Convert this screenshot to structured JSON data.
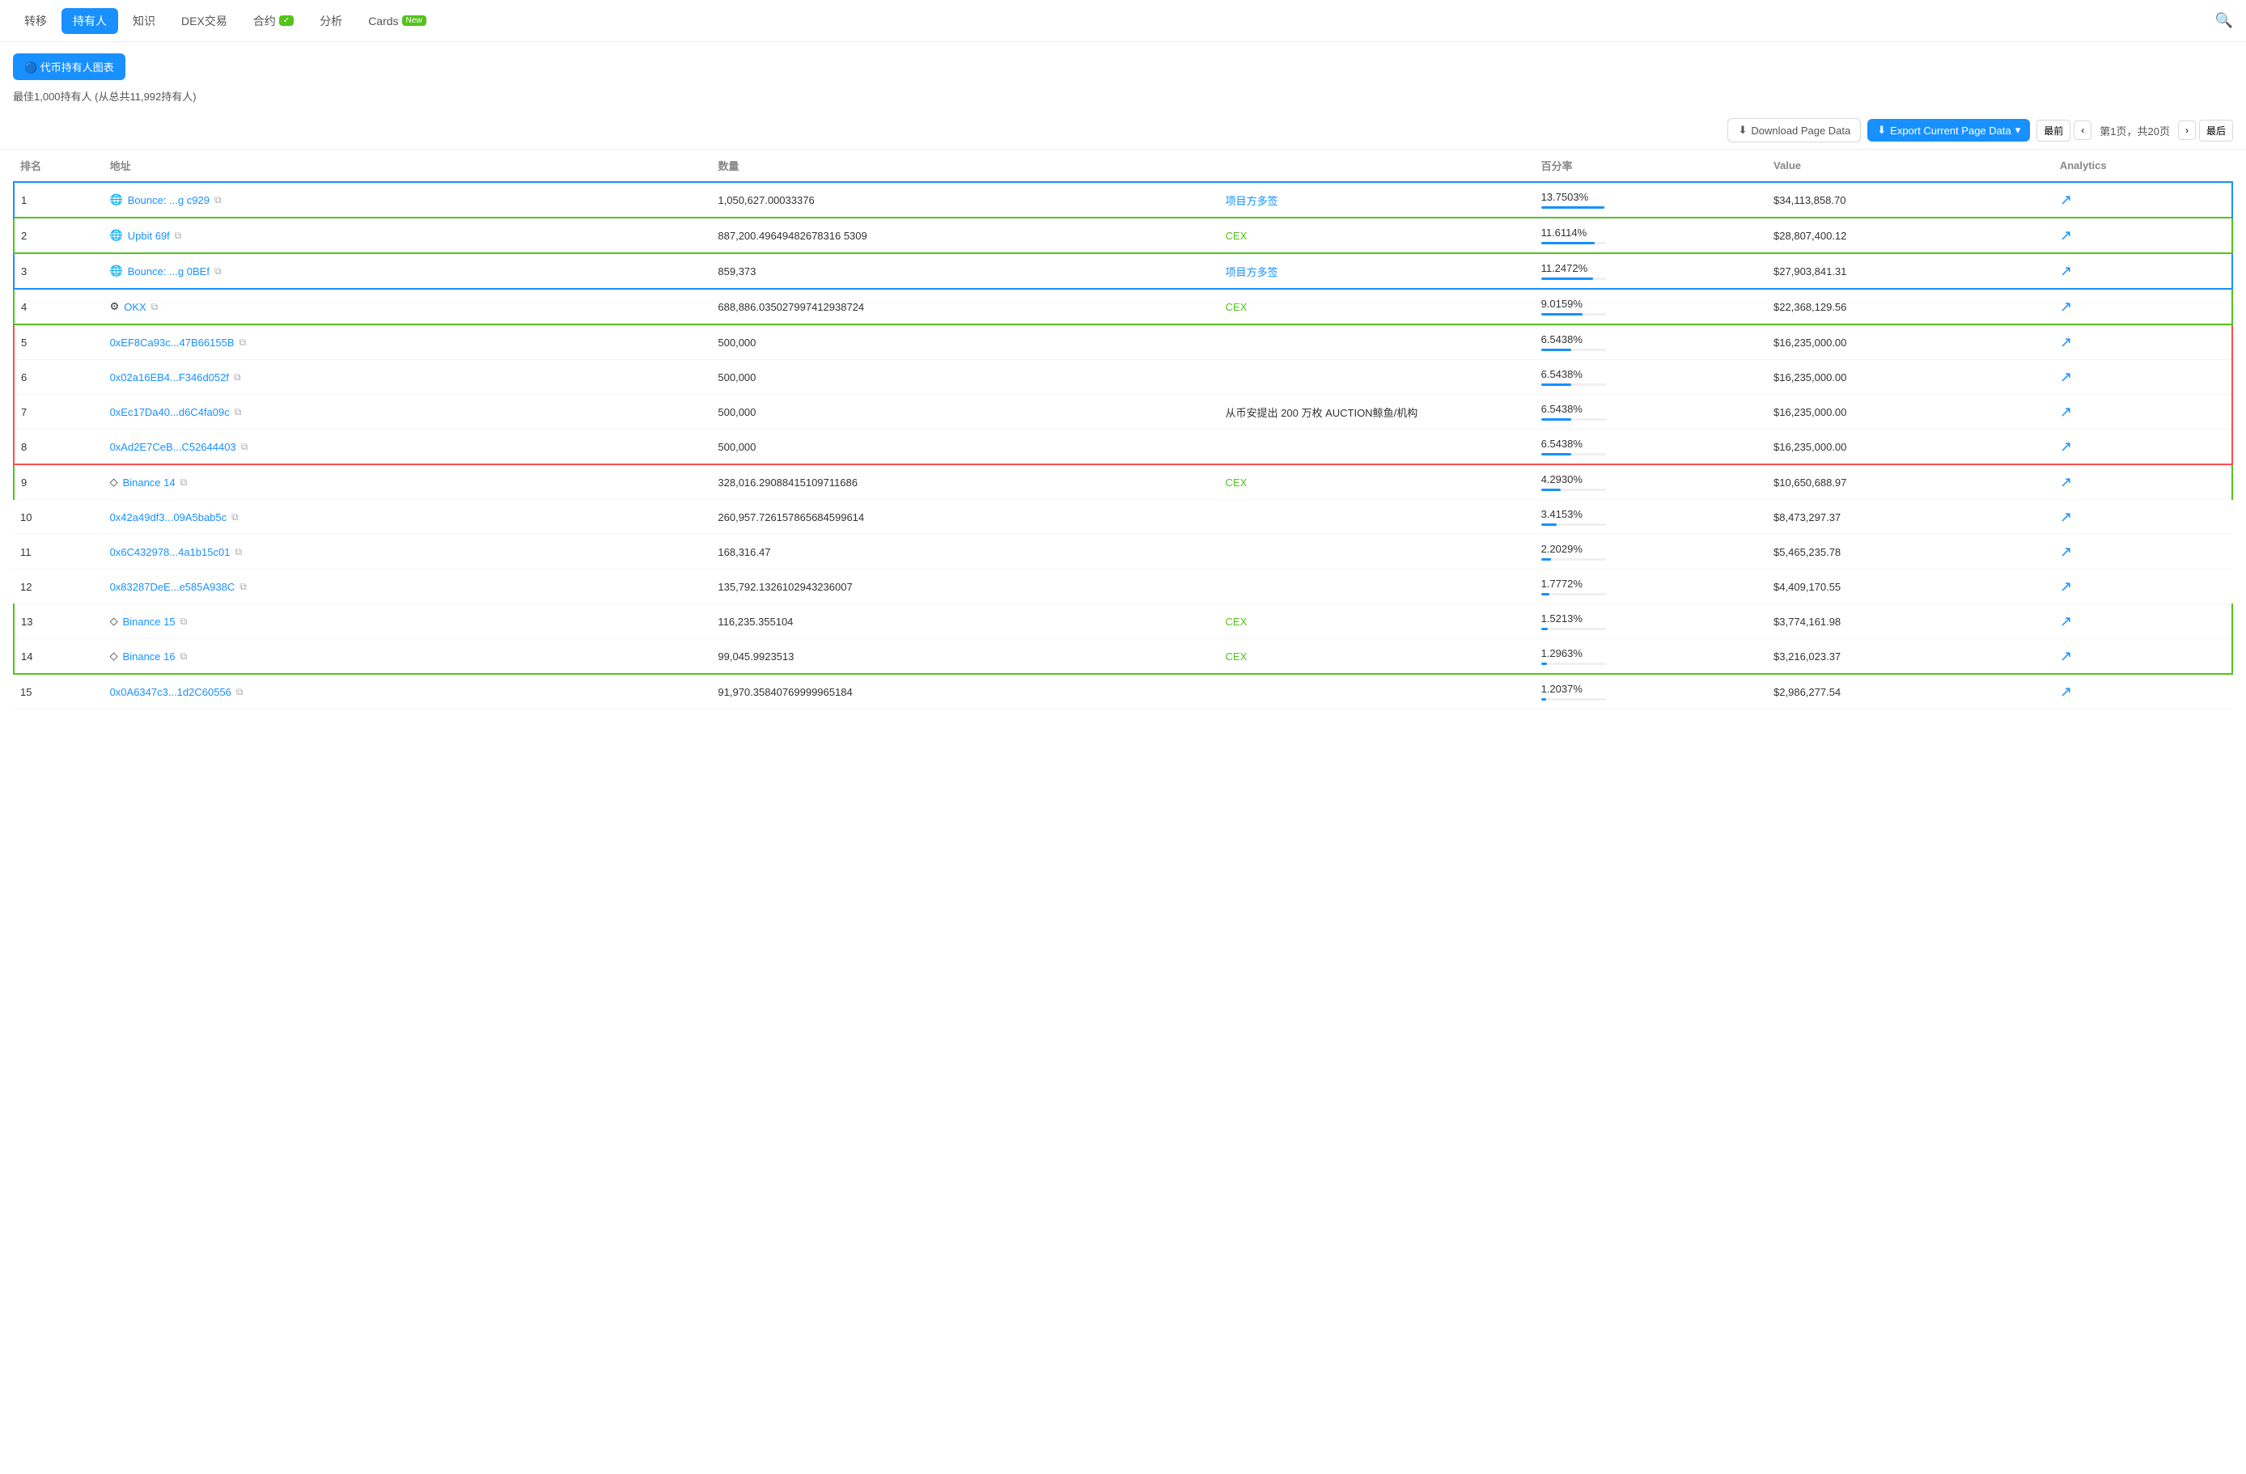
{
  "nav": {
    "items": [
      {
        "id": "transfer",
        "label": "转移",
        "active": false
      },
      {
        "id": "holders",
        "label": "持有人",
        "active": true
      },
      {
        "id": "knowledge",
        "label": "知识",
        "active": false
      },
      {
        "id": "dex",
        "label": "DEX交易",
        "active": false
      },
      {
        "id": "contract",
        "label": "合约",
        "active": false,
        "badge": "✓"
      },
      {
        "id": "analysis",
        "label": "分析",
        "active": false
      },
      {
        "id": "cards",
        "label": "Cards",
        "active": false,
        "badge": "New"
      }
    ]
  },
  "toolbar": {
    "chart_btn": "🔵 代币持有人图表",
    "subtitle": "最佳1,000持有人 (从总共11,992持有人)",
    "download_label": "Download Page Data",
    "export_label": "Export Current Page Data",
    "pagination": {
      "first": "最前",
      "prev": "‹",
      "info": "第1页，共20页",
      "next": "›",
      "last": "最后"
    }
  },
  "table": {
    "headers": [
      "排名",
      "地址",
      "数量",
      "",
      "百分率",
      "Value",
      "Analytics"
    ],
    "rows": [
      {
        "rank": "1",
        "address": "Bounce: ...g c929",
        "icon": "🌐",
        "quantity": "1,050,627.00033376",
        "label": "项目方多签",
        "label_color": "blue",
        "percent": "13.7503%",
        "percent_val": 13.7503,
        "value": "$34,113,858.70",
        "group": "blue",
        "group_pos": "start"
      },
      {
        "rank": "2",
        "address": "Upbit 69f",
        "icon": "🌐",
        "quantity": "887,200.49649482678316 5309",
        "label": "CEX",
        "label_color": "green",
        "percent": "11.6114%",
        "percent_val": 11.6114,
        "value": "$28,807,400.12",
        "group": "green",
        "group_pos": "single"
      },
      {
        "rank": "3",
        "address": "Bounce: ...g 0BEf",
        "icon": "🌐",
        "quantity": "859,373",
        "label": "项目方多签",
        "label_color": "blue",
        "percent": "11.2472%",
        "percent_val": 11.2472,
        "value": "$27,903,841.31",
        "group": "blue",
        "group_pos": "end"
      },
      {
        "rank": "4",
        "address": "OKX",
        "icon": "⚙️",
        "quantity": "688,886.035027997412938724",
        "label": "CEX",
        "label_color": "green",
        "percent": "9.0159%",
        "percent_val": 9.0159,
        "value": "$22,368,129.56",
        "group": "green2",
        "group_pos": "single"
      },
      {
        "rank": "5",
        "address": "0xEF8Ca93c...47B66155B",
        "icon": "",
        "quantity": "500,000",
        "label": "",
        "label_color": "",
        "percent": "6.5438%",
        "percent_val": 6.5438,
        "value": "$16,235,000.00",
        "group": "red",
        "group_pos": "start"
      },
      {
        "rank": "6",
        "address": "0x02a16EB4...F346d052f",
        "icon": "",
        "quantity": "500,000",
        "label": "",
        "label_color": "",
        "percent": "6.5438%",
        "percent_val": 6.5438,
        "value": "$16,235,000.00",
        "group": "red",
        "group_pos": "middle"
      },
      {
        "rank": "7",
        "address": "0xEc17Da40...d6C4fa09c",
        "icon": "",
        "quantity": "500,000",
        "label": "从币安提出 200 万枚 AUCTION鲸鱼/机构",
        "label_color": "orange",
        "percent": "6.5438%",
        "percent_val": 6.5438,
        "value": "$16,235,000.00",
        "group": "red",
        "group_pos": "middle"
      },
      {
        "rank": "8",
        "address": "0xAd2E7CeB...C52644403",
        "icon": "",
        "quantity": "500,000",
        "label": "",
        "label_color": "",
        "percent": "6.5438%",
        "percent_val": 6.5438,
        "value": "$16,235,000.00",
        "group": "red",
        "group_pos": "end"
      },
      {
        "rank": "9",
        "address": "Binance 14",
        "icon": "◇",
        "quantity": "328,016.29088415109711686",
        "label": "CEX",
        "label_color": "green",
        "percent": "4.2930%",
        "percent_val": 4.293,
        "value": "$10,650,688.97",
        "group": "green3",
        "group_pos": "start"
      },
      {
        "rank": "10",
        "address": "0x42a49df3...09A5bab5c",
        "icon": "",
        "quantity": "260,957.726157865684599614",
        "label": "",
        "label_color": "",
        "percent": "3.4153%",
        "percent_val": 3.4153,
        "value": "$8,473,297.37",
        "group": "none",
        "group_pos": ""
      },
      {
        "rank": "11",
        "address": "0x6C432978...4a1b15c01",
        "icon": "",
        "quantity": "168,316.47",
        "label": "",
        "label_color": "",
        "percent": "2.2029%",
        "percent_val": 2.2029,
        "value": "$5,465,235.78",
        "group": "none",
        "group_pos": ""
      },
      {
        "rank": "12",
        "address": "0x83287DeE...e585A938C",
        "icon": "",
        "quantity": "135,792.1326102943236007",
        "label": "",
        "label_color": "",
        "percent": "1.7772%",
        "percent_val": 1.7772,
        "value": "$4,409,170.55",
        "group": "none",
        "group_pos": ""
      },
      {
        "rank": "13",
        "address": "Binance 15",
        "icon": "◇",
        "quantity": "116,235.355104",
        "label": "CEX",
        "label_color": "green",
        "percent": "1.5213%",
        "percent_val": 1.5213,
        "value": "$3,774,161.98",
        "group": "green3",
        "group_pos": "middle"
      },
      {
        "rank": "14",
        "address": "Binance 16",
        "icon": "◇",
        "quantity": "99,045.9923513",
        "label": "CEX",
        "label_color": "green",
        "percent": "1.2963%",
        "percent_val": 1.2963,
        "value": "$3,216,023.37",
        "group": "green3",
        "group_pos": "end"
      },
      {
        "rank": "15",
        "address": "0x0A6347c3...1d2C60556",
        "icon": "",
        "quantity": "91,970.35840769999965184",
        "label": "",
        "label_color": "",
        "percent": "1.2037%",
        "percent_val": 1.2037,
        "value": "$2,986,277.54",
        "group": "none",
        "group_pos": ""
      }
    ]
  }
}
